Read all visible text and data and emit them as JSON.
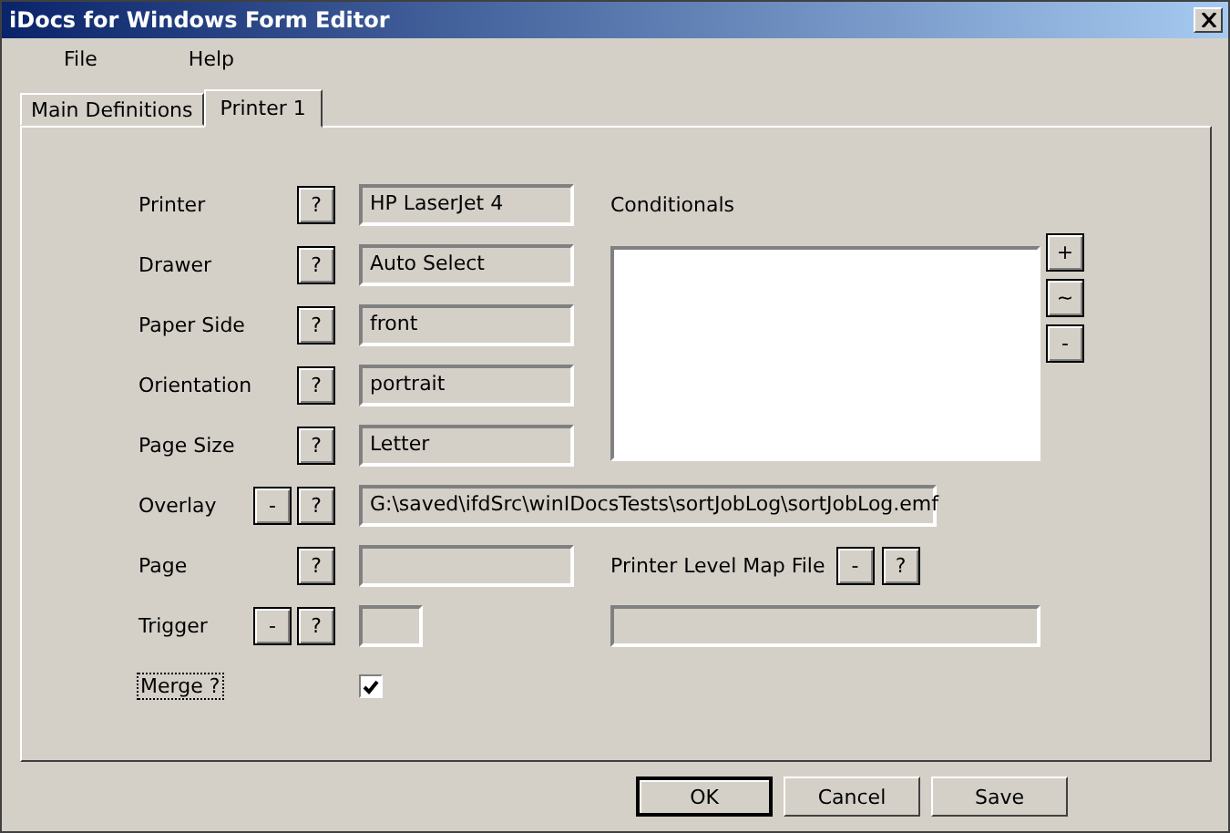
{
  "window": {
    "title": "iDocs for Windows Form Editor"
  },
  "menu": [
    "File",
    "Help"
  ],
  "tabs": [
    {
      "label": "Main Definitions",
      "selected": false
    },
    {
      "label": "Printer 1",
      "selected": true
    }
  ],
  "fields": [
    {
      "label": "Printer",
      "kind": "normal",
      "value": "HP LaserJet 4",
      "buttons": [
        "?"
      ]
    },
    {
      "label": "Drawer",
      "kind": "normal",
      "value": "Auto Select",
      "buttons": [
        "?"
      ]
    },
    {
      "label": "Paper Side",
      "kind": "normal",
      "value": "front",
      "buttons": [
        "?"
      ]
    },
    {
      "label": "Orientation",
      "kind": "normal",
      "value": "portrait",
      "buttons": [
        "?"
      ]
    },
    {
      "label": "Page Size",
      "kind": "normal",
      "value": "Letter",
      "buttons": [
        "?"
      ]
    },
    {
      "label": "Overlay",
      "kind": "wide",
      "value": "G:\\saved\\ifdSrc\\winIDocsTests\\sortJobLog\\sortJobLog.emf",
      "buttons": [
        "-",
        "?"
      ]
    },
    {
      "label": "Page",
      "kind": "normal",
      "buttons": [
        "?"
      ]
    },
    {
      "label": "Trigger",
      "kind": "short",
      "buttons": [
        "-",
        "?"
      ]
    }
  ],
  "merge": {
    "label": "Merge ?",
    "checked": true
  },
  "conditionals": {
    "label": "Conditionals",
    "buttons": [
      "+",
      "~",
      "-"
    ]
  },
  "map_file": {
    "label": "Printer Level Map File",
    "buttons": [
      "-",
      "?"
    ]
  },
  "dialog_buttons": [
    {
      "label": "OK",
      "default": true
    },
    {
      "label": "Cancel",
      "default": false
    },
    {
      "label": "Save",
      "default": false
    }
  ]
}
